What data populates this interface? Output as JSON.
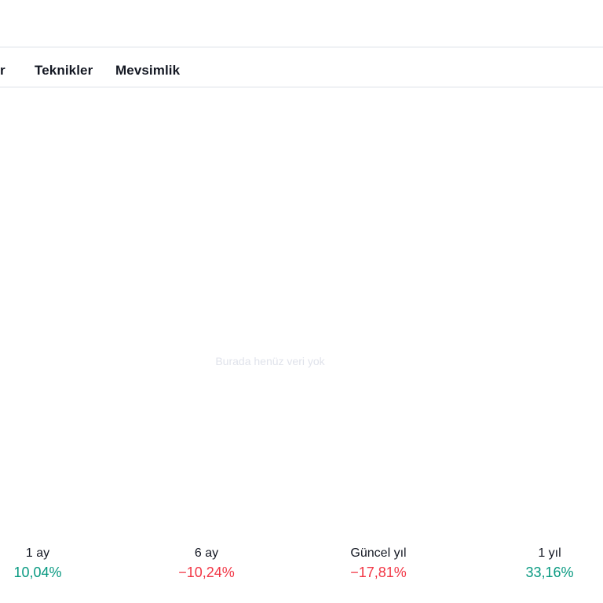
{
  "tabs": {
    "partial_label": "r",
    "items": [
      {
        "label": "Teknikler"
      },
      {
        "label": "Mevsimlik"
      }
    ]
  },
  "empty_state": {
    "message": "Burada henüz veri yok"
  },
  "performance": {
    "items": [
      {
        "label": "1 ay",
        "value": "10,04%",
        "direction": "up"
      },
      {
        "label": "6 ay",
        "value": "−10,24%",
        "direction": "down"
      },
      {
        "label": "Güncel yıl",
        "value": "−17,81%",
        "direction": "down"
      },
      {
        "label": "1 yıl",
        "value": "33,16%",
        "direction": "up"
      }
    ]
  },
  "colors": {
    "positive": "#089981",
    "negative": "#f23645",
    "text": "#131722",
    "muted_text": "#e0e3eb",
    "divider": "#f0f2f5"
  }
}
